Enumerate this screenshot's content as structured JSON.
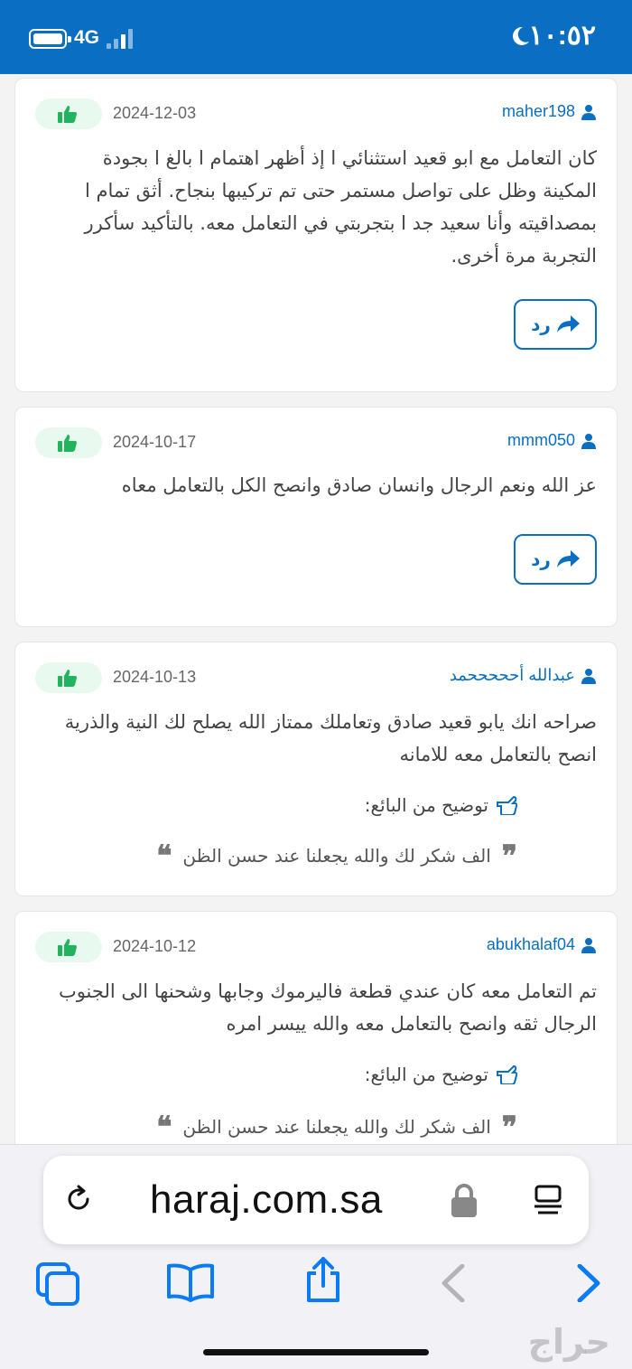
{
  "status_bar": {
    "time": "١٠:٥٢",
    "network": "4G"
  },
  "reviews": [
    {
      "user": "maher198",
      "date": "2024-12-03",
      "lines": [
        "كان التعامل مع ابو قعيد استثنائي ا إذ أظهر اهتمام ا بالغ ا بجودة",
        "المكينة وظل على تواصل مستمر حتى تم تركيبها بنجاح. أثق تمام ا",
        "بمصداقيته وأنا سعيد جد ا بتجربتي في التعامل معه. بالتأكيد سأكرر",
        "التجربة مرة أخرى."
      ],
      "reply_label": "رد"
    },
    {
      "user": "mmm050",
      "date": "2024-10-17",
      "lines": [
        "عز الله ونعم الرجال وانسان صادق وانصح الكل بالتعامل معاه"
      ],
      "reply_label": "رد"
    },
    {
      "user": "عبدالله أحححححمد",
      "date": "2024-10-13",
      "lines": [
        "صراحه انك يابو قعيد صادق وتعاملك ممتاز الله يصلح لك النية والذرية",
        "انصح بالتعامل معه للامانه"
      ],
      "seller_label": "توضيح من البائع:",
      "seller_reply": "الف شكر لك والله يجعلنا عند حسن الظن"
    },
    {
      "user": "abukhalaf04",
      "date": "2024-10-12",
      "lines": [
        "تم التعامل معه كان عندي قطعة فاليرموك وجابها وشحنها الى الجنوب",
        "الرجال ثقه وانصح بالتعامل معه والله ييسر امره"
      ],
      "seller_label": "توضيح من البائع:",
      "seller_reply": "الف شكر لك والله يجعلنا عند حسن الظن"
    }
  ],
  "browser": {
    "url": "haraj.com.sa"
  },
  "watermark": "حراج",
  "colors": {
    "accent": "#0a6fc2",
    "like": "#22b35e",
    "like_bg": "#e8faf0"
  }
}
